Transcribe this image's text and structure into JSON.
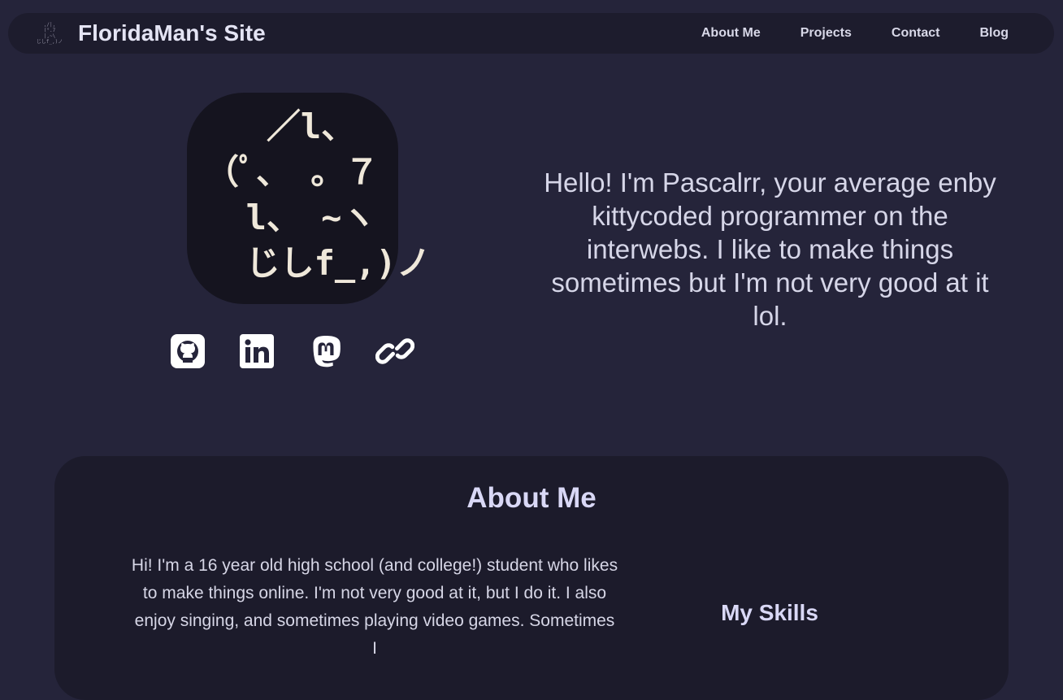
{
  "nav": {
    "logo_art": ",/|,\n(°.7\n|,~\\\nじしf_,)ノ",
    "title": "FloridaMan's Site",
    "links": [
      "About Me",
      "Projects",
      "Contact",
      "Blog"
    ]
  },
  "avatar": {
    "art": "   ／l、\n（ﾟ、 。７\n  l、 ~ヽ\n  じしf_,)ノ"
  },
  "social": [
    {
      "icon": "github-icon"
    },
    {
      "icon": "linkedin-icon"
    },
    {
      "icon": "mastodon-icon"
    },
    {
      "icon": "link-icon"
    }
  ],
  "hero": {
    "text": "Hello! I'm Pascalrr, your average enby kittycoded programmer on the interwebs. I like to make things sometimes but I'm not very good at it lol."
  },
  "about": {
    "heading": "About Me",
    "text": "Hi! I'm a 16 year old high school (and college!) student who likes to make things online. I'm not very good at it, but I do it. I also enjoy singing, and sometimes playing video games. Sometimes I",
    "skills_heading": "My Skills"
  },
  "colors": {
    "background": "#25243a",
    "navbar": "#1d1c2d",
    "card": "#1c1b2b",
    "accent_text": "#d9d8f6"
  }
}
